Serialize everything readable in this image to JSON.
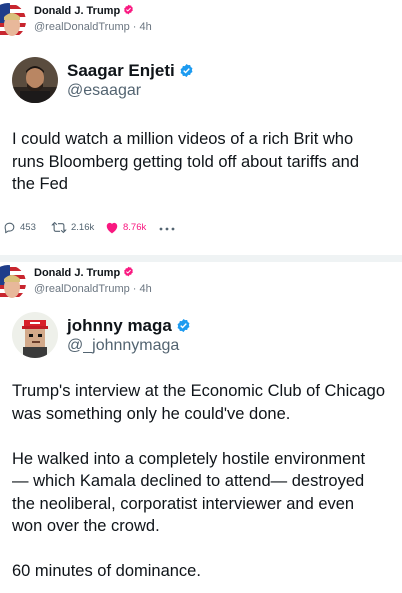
{
  "posts": [
    {
      "author": {
        "name": "Donald J. Trump",
        "handle": "@realDonaldTrump",
        "time": "4h",
        "meta": "@realDonaldTrump · 4h"
      },
      "quoted": {
        "name": "Saagar Enjeti",
        "handle": "@esaagar",
        "text_lines": [
          "I could watch a million videos of a rich Brit who",
          "runs Bloomberg getting told off about tariffs and",
          "the Fed"
        ]
      },
      "actions": {
        "replies": "453",
        "reposts": "2.16k",
        "likes": "8.76k"
      }
    },
    {
      "author": {
        "name": "Donald J. Trump",
        "handle": "@realDonaldTrump",
        "time": "4h",
        "meta": "@realDonaldTrump · 4h"
      },
      "quoted": {
        "name": "johnny maga",
        "handle": "@_johnnymaga",
        "paragraphs": [
          [
            "Trump's interview at the Economic Club of Chicago",
            "was something only he could've done."
          ],
          [
            "He walked into a completely hostile environment",
            "— which Kamala declined to attend— destroyed",
            "the neoliberal, corporatist interviewer and even",
            "won over the crowd."
          ],
          [
            "60 minutes of dominance."
          ]
        ]
      }
    }
  ],
  "colors": {
    "verified": "#f91880",
    "like": "#f91880",
    "muted": "#536471",
    "separator": "#eff3f4"
  },
  "icons": [
    "verified-badge-icon",
    "reply-icon",
    "repost-icon",
    "like-icon",
    "more-icon"
  ]
}
